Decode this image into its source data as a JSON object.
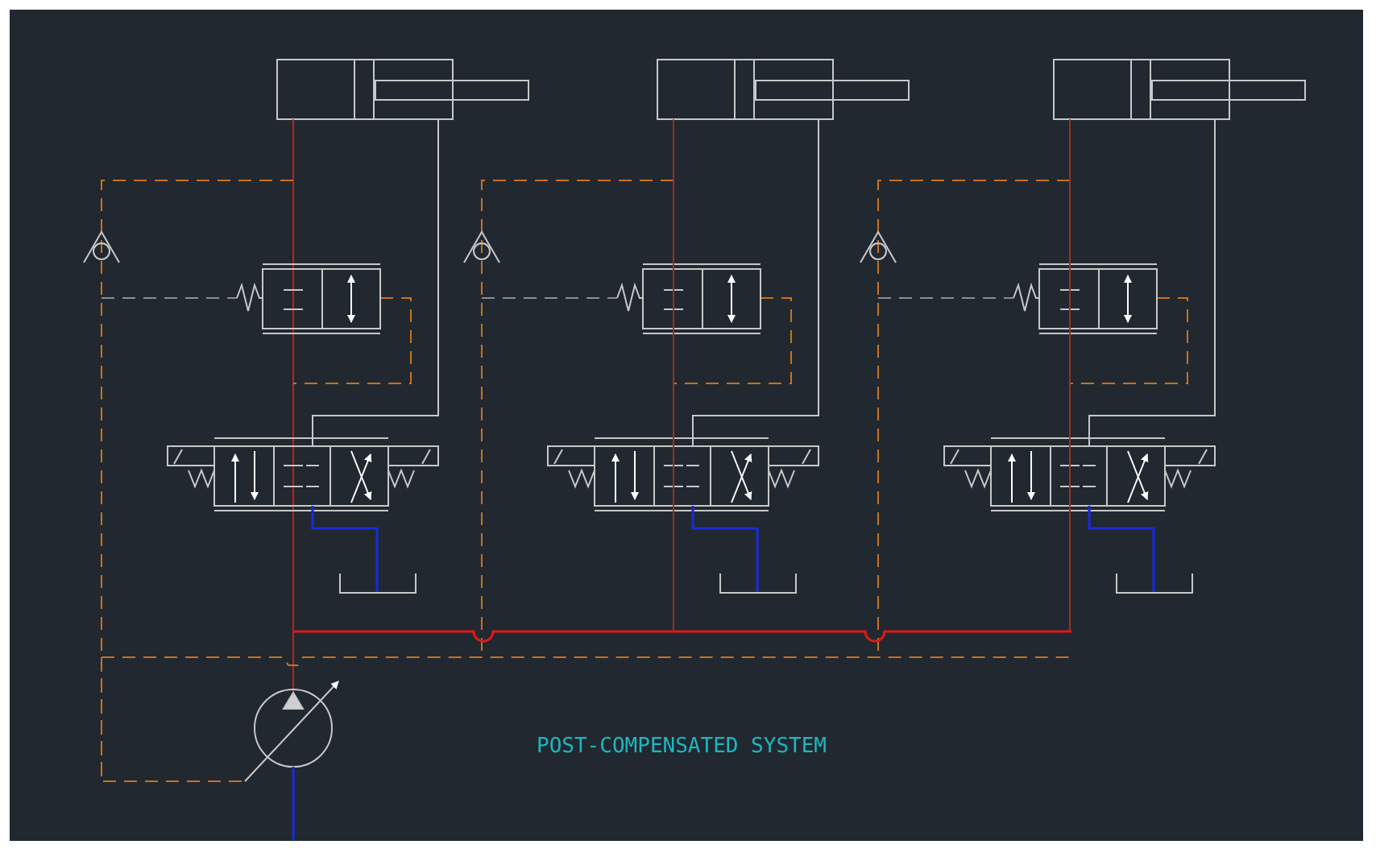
{
  "drawing": {
    "caption": "POST-COMPENSATED SYSTEM"
  }
}
